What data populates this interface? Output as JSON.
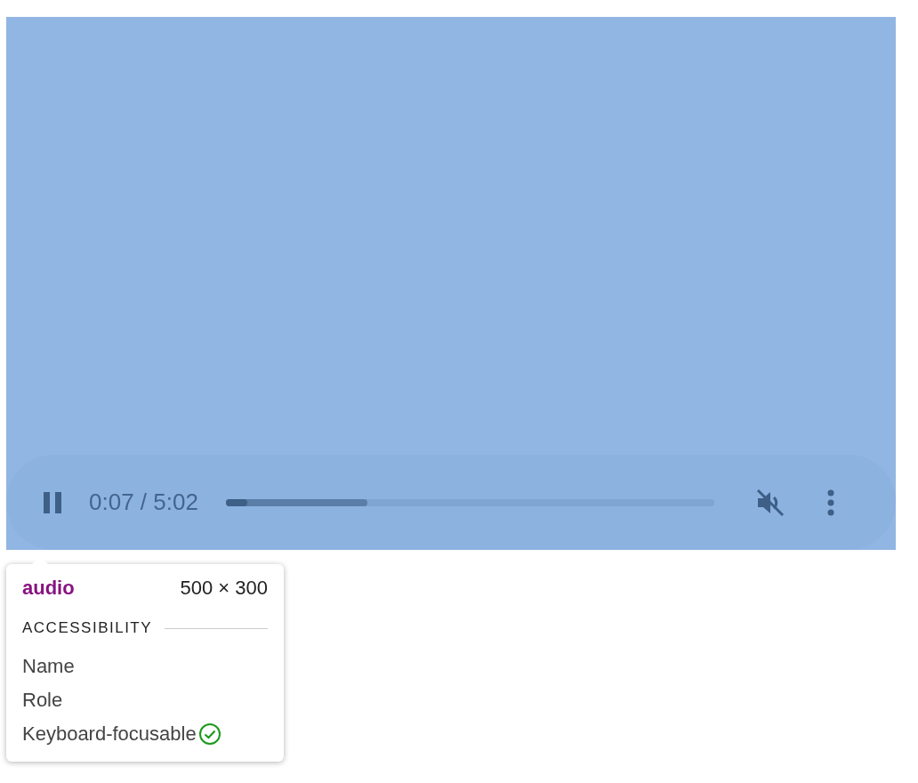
{
  "player": {
    "playing": true,
    "time": "0:07 / 5:02",
    "progress": {
      "level": 0.044
    },
    "buffer": {
      "level": 0.29
    },
    "muted": true
  },
  "tooltip": {
    "tag": "audio",
    "size": "500 × 300",
    "section": "ACCESSIBILITY",
    "rows": [
      {
        "label": "Name"
      },
      {
        "label": "Role"
      },
      {
        "label": "Keyboard-focusable",
        "check": true
      }
    ]
  }
}
